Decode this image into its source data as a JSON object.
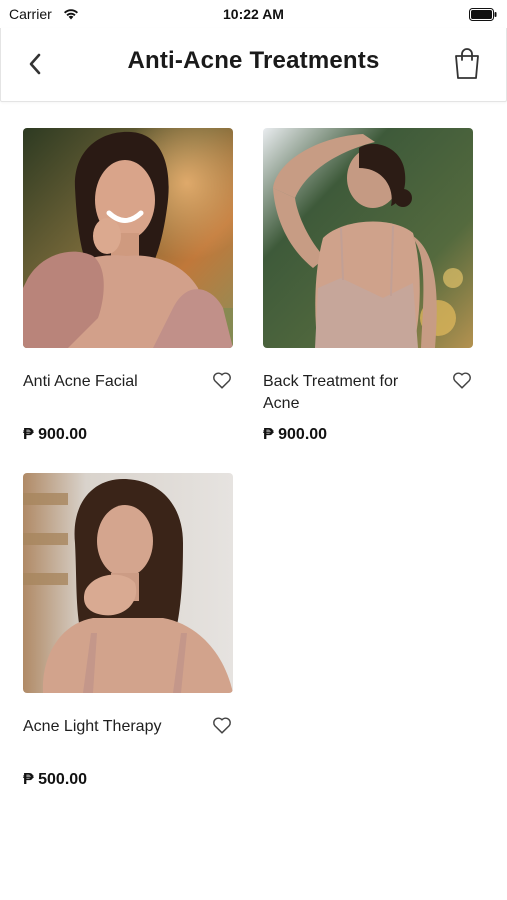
{
  "status_bar": {
    "carrier": "Carrier",
    "time": "10:22 AM"
  },
  "nav": {
    "title": "Anti-Acne Treatments",
    "back_icon": "chevron-left-icon",
    "cart_icon": "shopping-bag-icon"
  },
  "products": [
    {
      "name": "Anti Acne Facial",
      "price": "₱ 900.00",
      "favorite_icon": "heart-outline-icon"
    },
    {
      "name": "Back Treatment for Acne",
      "price": "₱ 900.00",
      "favorite_icon": "heart-outline-icon"
    },
    {
      "name": "Acne Light Therapy",
      "price": "₱ 500.00",
      "favorite_icon": "heart-outline-icon"
    }
  ],
  "colors": {
    "text": "#1a1a1a",
    "divider": "#e4e4e4",
    "background": "#ffffff"
  }
}
